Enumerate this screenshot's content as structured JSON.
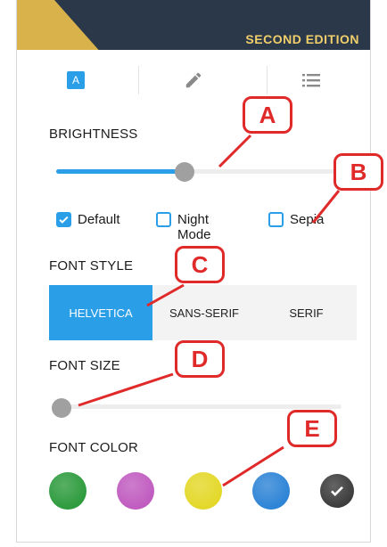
{
  "cover": {
    "edition_text": "SECOND EDITION"
  },
  "tabs": [
    {
      "icon": "text-format-icon",
      "glyph": "A"
    },
    {
      "icon": "pencil-icon"
    },
    {
      "icon": "list-icon"
    }
  ],
  "brightness": {
    "label": "BRIGHTNESS",
    "level": 0.45
  },
  "theme": {
    "default_label": "Default",
    "default_checked": true,
    "night_label": "Night Mode",
    "night_checked": false,
    "sepia_label": "Sepia",
    "sepia_checked": false
  },
  "font_style": {
    "label": "FONT STYLE",
    "options": [
      "HELVETICA",
      "SANS-SERIF",
      "SERIF"
    ],
    "selected": "HELVETICA"
  },
  "font_size": {
    "label": "FONT SIZE",
    "level": 0.0
  },
  "font_color": {
    "label": "FONT COLOR",
    "swatches": [
      "#2e9b3e",
      "#c05cc0",
      "#e3d829",
      "#2e84d6",
      "#3d3d3d"
    ],
    "selected_index": 4
  },
  "callouts": [
    "A",
    "B",
    "C",
    "D",
    "E"
  ]
}
